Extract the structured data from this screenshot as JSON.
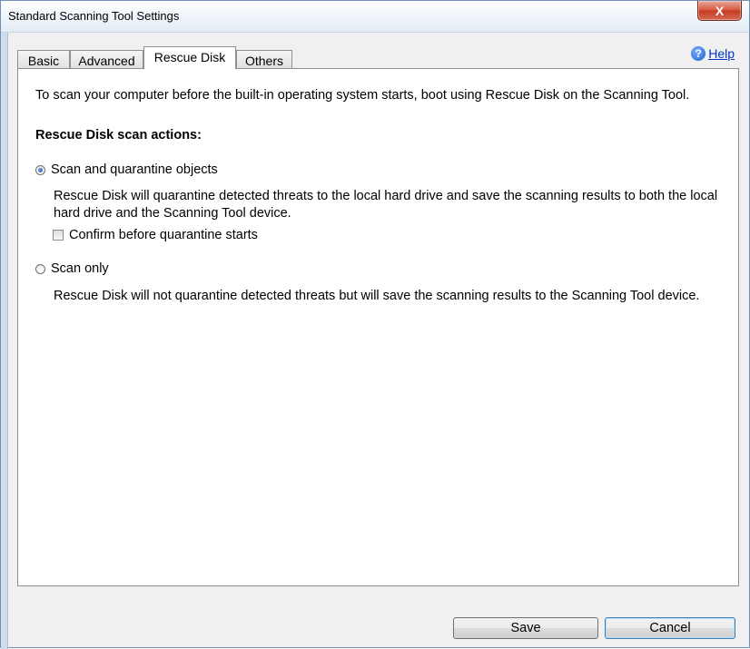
{
  "window": {
    "title": "Standard Scanning Tool Settings",
    "close_label": "X"
  },
  "tabs": [
    {
      "label": "Basic",
      "active": false
    },
    {
      "label": "Advanced",
      "active": false
    },
    {
      "label": "Rescue Disk",
      "active": true
    },
    {
      "label": "Others",
      "active": false
    }
  ],
  "help": {
    "label": "Help",
    "icon": "question-icon",
    "glyph": "?"
  },
  "panel": {
    "intro": "To scan your computer before the built-in operating system starts, boot using Rescue Disk on the Scanning Tool.",
    "heading": "Rescue Disk scan actions:",
    "options": [
      {
        "label": "Scan and quarantine objects",
        "selected": true,
        "description": "Rescue Disk will quarantine detected threats to the local hard drive and save the scanning results to both the local hard drive and the Scanning Tool device."
      },
      {
        "label": "Scan only",
        "selected": false,
        "description": "Rescue Disk will not quarantine detected threats but will save the scanning results to the Scanning Tool device."
      }
    ],
    "confirm_checkbox": {
      "label": "Confirm before quarantine starts",
      "checked": false
    }
  },
  "buttons": {
    "save": "Save",
    "cancel": "Cancel"
  },
  "colors": {
    "link": "#0033cc",
    "close_button": "#c43b22",
    "default_button_border": "#3c7fb1"
  }
}
